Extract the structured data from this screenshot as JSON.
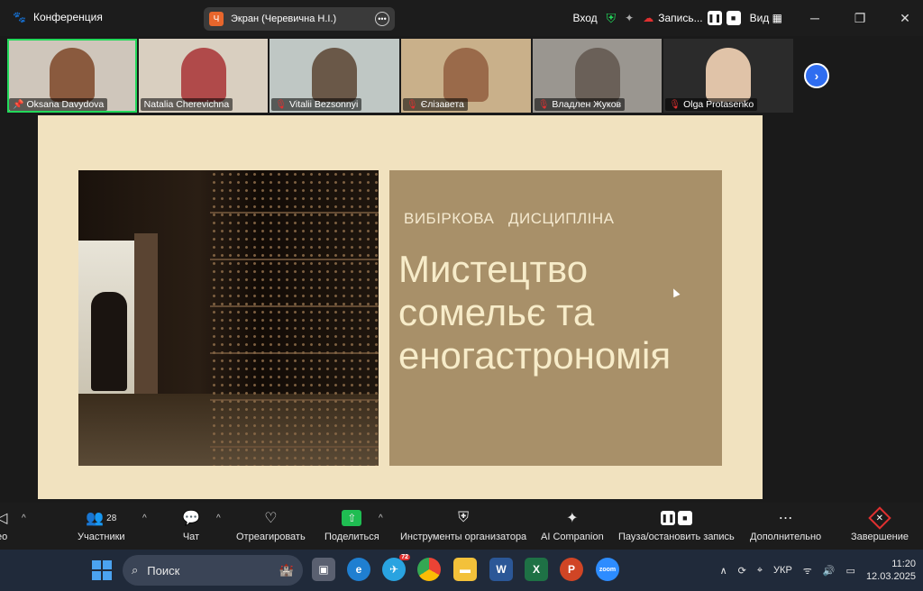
{
  "window": {
    "title": "Конференция",
    "share_label": "Экран (Черевична Н.І.)",
    "share_badge": "Ч",
    "login_label": "Вход",
    "record_label": "Запись...",
    "view_label": "Вид"
  },
  "participants": [
    {
      "name": "Oksana Davydova",
      "muted": false,
      "pinned": true,
      "active": true,
      "bg": "#cfc6bb",
      "face": "#8a5a3e"
    },
    {
      "name": "Natalia Cherevichna",
      "muted": false,
      "pinned": false,
      "active": false,
      "bg": "#d9cfc0",
      "face": "#b04a4a"
    },
    {
      "name": "Vitalii Bezsonnyi",
      "muted": true,
      "pinned": false,
      "active": false,
      "bg": "#bfc7c4",
      "face": "#6a5848"
    },
    {
      "name": "Єлізавета",
      "muted": true,
      "pinned": false,
      "active": false,
      "bg": "#c9b08a",
      "face": "#9a6a4a"
    },
    {
      "name": "Владлен Жуков",
      "muted": true,
      "pinned": false,
      "active": false,
      "bg": "#9a9690",
      "face": "#6a6058"
    },
    {
      "name": "Olga Protasenko",
      "muted": true,
      "pinned": false,
      "active": false,
      "bg": "#2b2b2b",
      "face": "#e0c3a8"
    }
  ],
  "slide": {
    "subtitle": "ВИБІРКОВА   ДИСЦИПЛІНА",
    "title": "Мистецтво сомельє та еногастрономія"
  },
  "toolbar": {
    "video_label": "ео",
    "participants_label": "Участники",
    "participants_count": "28",
    "chat_label": "Чат",
    "react_label": "Отреагировать",
    "share_label": "Поделиться",
    "host_tools_label": "Инструменты организатора",
    "ai_label": "AI Companion",
    "pause_record_label": "Пауза/остановить запись",
    "more_label": "Дополнительно",
    "end_label": "Завершение"
  },
  "taskbar": {
    "search_placeholder": "Поиск",
    "telegram_badge": "72",
    "lang": "УКР",
    "time": "11:20",
    "date": "12.03.2025",
    "zoom_label": "zoom"
  }
}
